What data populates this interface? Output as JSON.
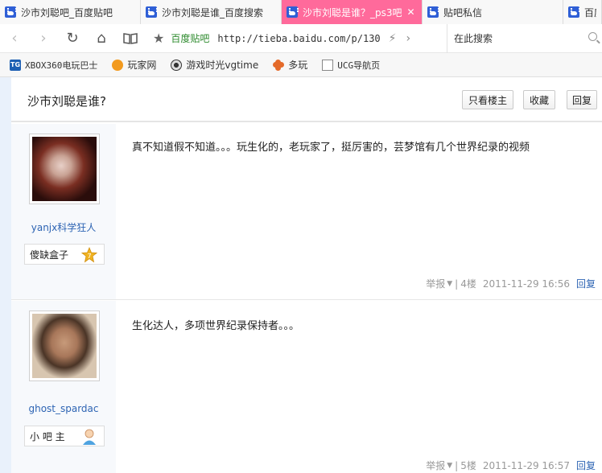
{
  "tabs": [
    {
      "title": "沙市刘聪吧_百度贴吧",
      "active": false
    },
    {
      "title": "沙市刘聪是谁_百度搜索",
      "active": false
    },
    {
      "title": "沙市刘聪是谁？_ps3吧",
      "active": true
    },
    {
      "title": "贴吧私信",
      "active": false
    },
    {
      "title": "百度",
      "active": false
    }
  ],
  "nav": {
    "site_label": "百度贴吧",
    "url": "http://tieba.baidu.com/p/130",
    "search_placeholder": "在此搜索"
  },
  "bookmarks": [
    {
      "icon": "tg-icon",
      "label": "XBOX360电玩巴士"
    },
    {
      "icon": "game-icon",
      "label": "玩家网"
    },
    {
      "icon": "clock-icon",
      "label": "游戏时光vgtime"
    },
    {
      "icon": "duowan-icon",
      "label": "多玩"
    },
    {
      "icon": "page-icon",
      "label": "UCG导航页"
    }
  ],
  "thread": {
    "title": "沙市刘聪是谁?",
    "buttons": {
      "only_op": "只看楼主",
      "favorite": "收藏",
      "reply": "回复"
    }
  },
  "posts": [
    {
      "username": "yanjx科学狂人",
      "title_badge": "傻缺盒子",
      "level": "7",
      "content": "真不知道假不知道。。。玩生化的，老玩家了，挺厉害的，芸梦馆有几个世界纪录的视频",
      "report": "举报",
      "floor": "4楼",
      "time": "2011-11-29 16:56",
      "reply": "回复"
    },
    {
      "username": "ghost_spardac",
      "title_badge": "小 吧 主",
      "content": "生化达人，多项世界纪录保持者。。。",
      "report": "举报",
      "floor": "5楼",
      "time": "2011-11-29 16:57",
      "reply": "回复"
    }
  ],
  "colors": {
    "active_tab": "#ff6a9b",
    "link": "#2d64b3",
    "site_label": "#2e8b2e"
  }
}
